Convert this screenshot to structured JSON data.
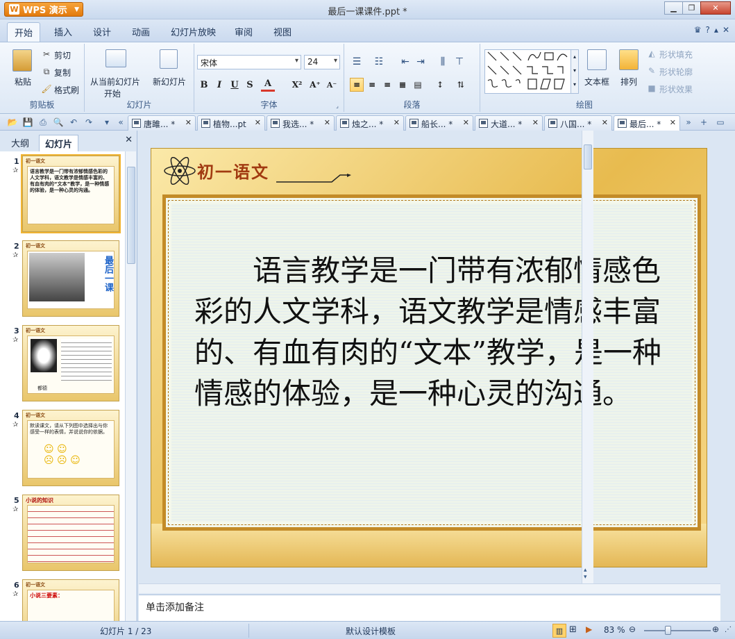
{
  "window": {
    "app_button": "WPS 演示",
    "title": "最后一课课件.ppt *"
  },
  "menu": {
    "tabs": [
      "开始",
      "插入",
      "设计",
      "动画",
      "幻灯片放映",
      "审阅",
      "视图"
    ],
    "active": "开始"
  },
  "ribbon": {
    "clipboard": {
      "paste": "粘贴",
      "cut": "剪切",
      "copy": "复制",
      "format_painter": "格式刷",
      "label": "剪贴板"
    },
    "slides": {
      "from_current_1": "从当前幻灯片",
      "from_current_2": "开始",
      "new_slide": "新幻灯片",
      "label": "幻灯片"
    },
    "font": {
      "font_name": "宋体",
      "font_size": "24",
      "bold": "B",
      "italic": "I",
      "underline": "U",
      "strike": "S",
      "color": "A",
      "super": "X²",
      "grow": "A⁺",
      "shrink": "A⁻",
      "label": "字体"
    },
    "paragraph": {
      "label": "段落"
    },
    "drawing": {
      "textbox": "文本框",
      "arrange": "排列",
      "shape_fill": "形状填充",
      "shape_outline": "形状轮廓",
      "shape_effect": "形状效果",
      "label": "绘图"
    }
  },
  "doc_tabs": [
    {
      "label": "唐雎... *",
      "active": false
    },
    {
      "label": "植物...pt",
      "active": false
    },
    {
      "label": "我选... *",
      "active": false
    },
    {
      "label": "烛之... *",
      "active": false
    },
    {
      "label": "船长... *",
      "active": false
    },
    {
      "label": "大道... *",
      "active": false
    },
    {
      "label": "八国... *",
      "active": false
    },
    {
      "label": "最后... *",
      "active": true
    }
  ],
  "left_pane": {
    "tabs": [
      "大纲",
      "幻灯片"
    ],
    "active_tab": "幻灯片",
    "thumbnails": [
      {
        "num": "1",
        "text": "语言教学是一门带有浓郁情感色彩的人文学科，语文教学是情感丰富的、有血有肉的“文本”教学，是一种情感的体验，是一种心灵的沟通。"
      },
      {
        "num": "2",
        "text": "最后一课"
      },
      {
        "num": "3",
        "text": "都德"
      },
      {
        "num": "4",
        "text": "默读课文，请从下列图中选择出与你感受一样的表情，并说说你的依据。"
      },
      {
        "num": "5",
        "text": "小说的知识"
      },
      {
        "num": "6",
        "text": "小说三要素："
      }
    ]
  },
  "slide": {
    "header": "初一语文",
    "body": "语言教学是一门带有浓郁情感色彩的人文学科，语文教学是情感丰富的、有血有肉的“文本”教学，是一种情感的体验，是一种心灵的沟通。"
  },
  "notes": {
    "placeholder": "单击添加备注"
  },
  "status": {
    "slide_counter": "幻灯片 1 / 23",
    "template": "默认设计模板",
    "zoom": "83 %"
  },
  "colors": {
    "accent": "#e27a0e",
    "ribbon_bg": "#dde8f5",
    "slide_gold": "#e8bb4f",
    "header_red": "#a13a11"
  }
}
